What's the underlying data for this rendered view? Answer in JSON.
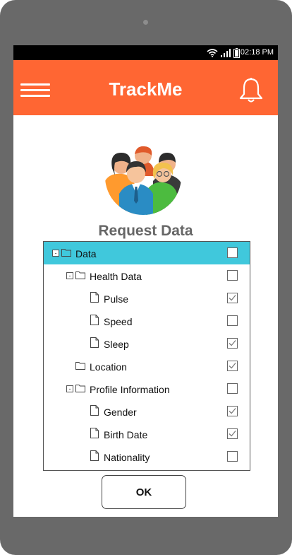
{
  "status_bar": {
    "time": "02:18 PM",
    "icons": [
      "wifi-icon",
      "signal-icon",
      "battery-icon"
    ]
  },
  "app_bar": {
    "title": "TrackMe",
    "menu_icon": "hamburger-menu-icon",
    "notification_icon": "bell-icon",
    "color": "#ff6633"
  },
  "avatar": {
    "icon": "group-of-people-icon"
  },
  "heading": "Request Data",
  "tree": {
    "selected_color": "#40c8dc",
    "items": [
      {
        "label": "Data",
        "type": "folder",
        "level": 0,
        "expander": "-",
        "checked": false,
        "selected": true
      },
      {
        "label": "Health Data",
        "type": "folder",
        "level": 1,
        "expander": "-",
        "checked": false,
        "selected": false
      },
      {
        "label": "Pulse",
        "type": "file",
        "level": 2,
        "expander": "",
        "checked": true,
        "selected": false
      },
      {
        "label": "Speed",
        "type": "file",
        "level": 2,
        "expander": "",
        "checked": false,
        "selected": false
      },
      {
        "label": "Sleep",
        "type": "file",
        "level": 2,
        "expander": "",
        "checked": true,
        "selected": false
      },
      {
        "label": "Location",
        "type": "folder",
        "level": 1,
        "expander": "",
        "checked": true,
        "selected": false
      },
      {
        "label": "Profile Information",
        "type": "folder",
        "level": 1,
        "expander": "-",
        "checked": false,
        "selected": false
      },
      {
        "label": "Gender",
        "type": "file",
        "level": 2,
        "expander": "",
        "checked": true,
        "selected": false
      },
      {
        "label": "Birth Date",
        "type": "file",
        "level": 2,
        "expander": "",
        "checked": true,
        "selected": false
      },
      {
        "label": "Nationality",
        "type": "file",
        "level": 2,
        "expander": "",
        "checked": false,
        "selected": false
      }
    ]
  },
  "ok_button": {
    "label": "OK"
  }
}
